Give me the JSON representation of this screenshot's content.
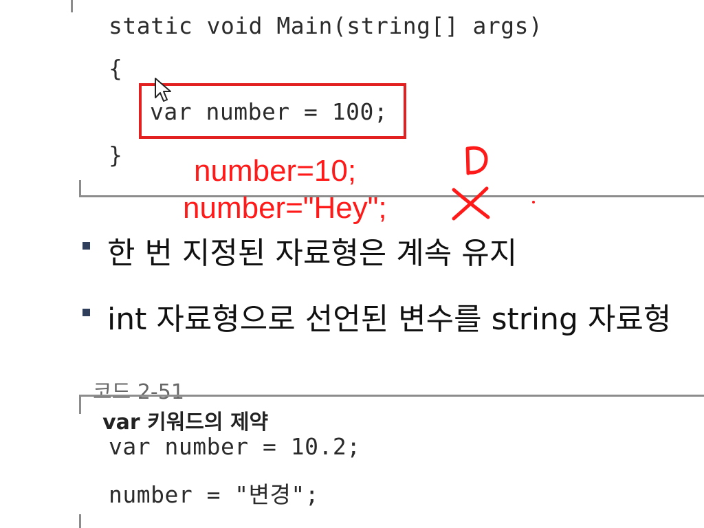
{
  "code_block_1": {
    "lines": [
      "static void Main(string[] args)",
      "{",
      "var number = 100;",
      "}"
    ]
  },
  "annotations": {
    "line1": "number=10;",
    "line2": "number=\"Hey\";",
    "ok_mark": "O",
    "x_mark": "X",
    "colors": {
      "ink": "#ff1a1a",
      "highlight": "#e32020"
    }
  },
  "bullets": [
    "한 번 지정된 자료형은 계속 유지",
    "int 자료형으로 선언된 변수를 string 자료형"
  ],
  "caption": {
    "number": "코드 2-51",
    "title": "var 키워드의 제약"
  },
  "code_block_2": {
    "lines": [
      "var number = 10.2;",
      "number = \"변경\";"
    ]
  },
  "icons": [
    "mouse-cursor-icon"
  ]
}
